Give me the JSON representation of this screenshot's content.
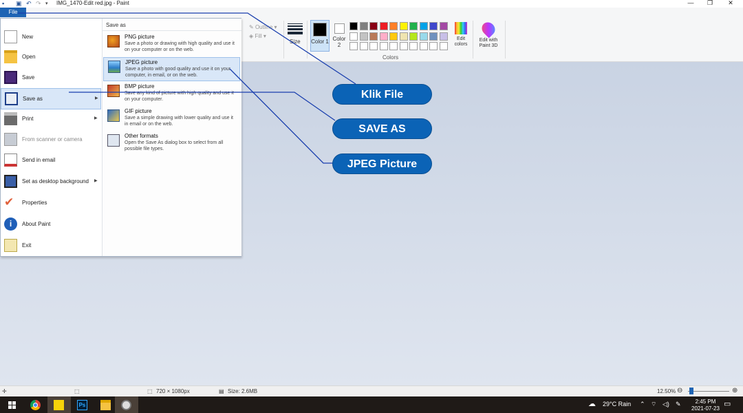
{
  "window": {
    "title": "IMG_1470-Edit red.jpg - Paint",
    "quick_access": [
      "save-icon",
      "undo-icon",
      "redo-icon",
      "customize-dropdown-icon"
    ],
    "controls": [
      "minimize",
      "maximize",
      "close"
    ]
  },
  "ribbon": {
    "file_tab": "File",
    "outline_label": "Outline",
    "fill_label": "Fill",
    "size_label": "Size",
    "color1_label": "Color 1",
    "color2_label": "Color 2",
    "colors_group_label": "Colors",
    "edit_colors_label": "Edit colors",
    "paint3d_label": "Edit with Paint 3D",
    "color1_value": "#000000",
    "color2_value": "#ffffff",
    "palette": [
      "#000000",
      "#7f7f7f",
      "#880015",
      "#ed1c24",
      "#ff7f27",
      "#fff200",
      "#22b14c",
      "#00a2e8",
      "#3f48cc",
      "#a349a4",
      "#ffffff",
      "#c3c3c3",
      "#b97a57",
      "#ffaec9",
      "#ffc90e",
      "#efe4b0",
      "#b5e61d",
      "#99d9ea",
      "#7092be",
      "#c8bfe7",
      "#ffffff",
      "#ffffff",
      "#ffffff",
      "#ffffff",
      "#ffffff",
      "#ffffff",
      "#ffffff",
      "#ffffff",
      "#ffffff",
      "#ffffff"
    ]
  },
  "file_menu": {
    "items": [
      {
        "label": "New",
        "icon": "new-file-icon"
      },
      {
        "label": "Open",
        "icon": "open-folder-icon"
      },
      {
        "label": "Save",
        "icon": "save-icon"
      },
      {
        "label": "Save as",
        "icon": "save-as-icon",
        "submenu": true
      },
      {
        "label": "Print",
        "icon": "printer-icon",
        "submenu": true
      },
      {
        "label": "From scanner or camera",
        "icon": "scanner-icon",
        "disabled": true
      },
      {
        "label": "Send in email",
        "icon": "email-icon"
      },
      {
        "label": "Set as desktop background",
        "icon": "desktop-background-icon",
        "submenu": true
      },
      {
        "label": "Properties",
        "icon": "checkmark-icon"
      },
      {
        "label": "About Paint",
        "icon": "info-icon"
      },
      {
        "label": "Exit",
        "icon": "exit-icon"
      }
    ],
    "save_as": {
      "header": "Save as",
      "formats": [
        {
          "title": "PNG picture",
          "desc": "Save a photo or drawing with high quality and use it on your computer or on the web.",
          "icon": "png-picture-icon"
        },
        {
          "title": "JPEG picture",
          "desc": "Save a photo with good quality and use it on your computer, in email, or on the web.",
          "icon": "jpeg-picture-icon"
        },
        {
          "title": "BMP picture",
          "desc": "Save any kind of picture with high quality and use it on your computer.",
          "icon": "bmp-picture-icon"
        },
        {
          "title": "GIF picture",
          "desc": "Save a simple drawing with lower quality and use it in email or on the web.",
          "icon": "gif-picture-icon"
        },
        {
          "title": "Other formats",
          "desc": "Open the Save As dialog box to select from all possible file types.",
          "icon": "other-formats-icon"
        }
      ]
    }
  },
  "annotations": {
    "klik_file": "Klik File",
    "save_as": "SAVE AS",
    "jpeg_picture": "JPEG Picture",
    "pill_color": "#0b63b6",
    "line_color": "#1a3fae"
  },
  "statusbar": {
    "dimensions": "720 × 1080px",
    "size": "Size: 2.6MB",
    "zoom": "12.50%",
    "zoom_minus": "⊖",
    "zoom_plus": "⊕"
  },
  "taskbar": {
    "apps": [
      "windows-start-icon",
      "chrome-icon",
      "sticky-notes-icon",
      "photoshop-icon",
      "file-explorer-icon",
      "paint-icon"
    ],
    "photoshop_label": "Ps",
    "weather": "29°C  Rain",
    "time": "2:45 PM",
    "date": "2021-07-23"
  }
}
